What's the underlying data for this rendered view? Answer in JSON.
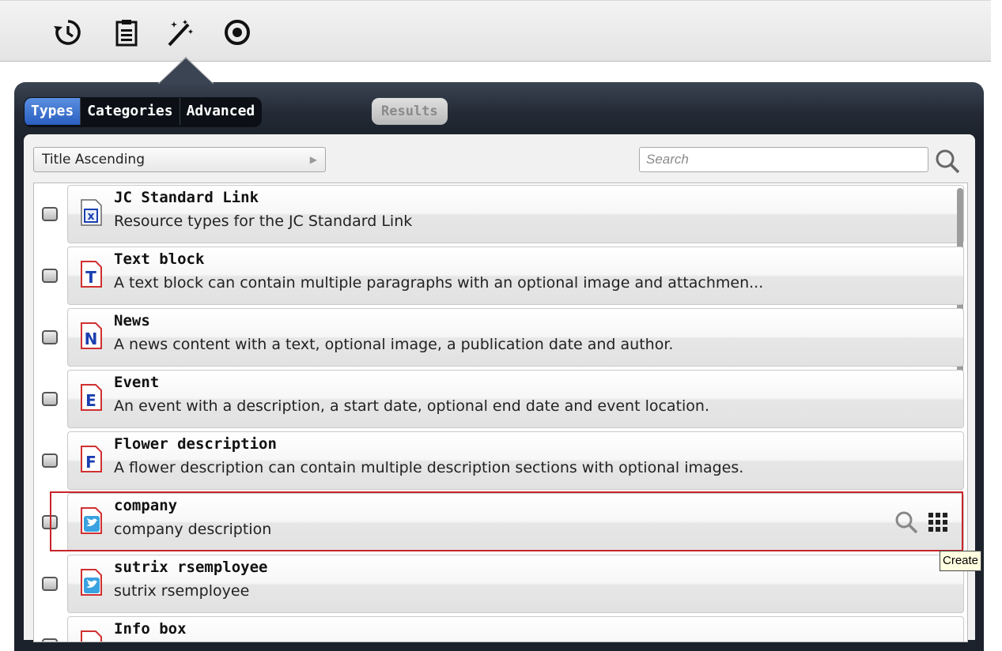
{
  "toolbar": {
    "icons": [
      "history-icon",
      "clipboard-icon",
      "magic-wand-icon",
      "target-icon"
    ]
  },
  "tabs": [
    {
      "label": "Types",
      "active": true
    },
    {
      "label": "Categories",
      "active": false
    },
    {
      "label": "Advanced",
      "active": false
    }
  ],
  "results_label": "Results",
  "sort": {
    "value": "Title Ascending"
  },
  "search": {
    "placeholder": "Search"
  },
  "items": [
    {
      "title": "JC Standard Link",
      "description": "Resource types for the JC Standard Link",
      "icon": "x-doc-icon",
      "letter": "x"
    },
    {
      "title": "Text block",
      "description": "A text block can contain multiple paragraphs with an optional image and attachmen...",
      "icon": "t-doc-icon",
      "letter": "T"
    },
    {
      "title": "News",
      "description": "A news content with a text, optional image, a publication date and author.",
      "icon": "n-doc-icon",
      "letter": "N"
    },
    {
      "title": "Event",
      "description": "An event with a description, a start date, optional end date and event location.",
      "icon": "e-doc-icon",
      "letter": "E"
    },
    {
      "title": "Flower description",
      "description": "A flower description can contain multiple description sections with optional images.",
      "icon": "f-doc-icon",
      "letter": "F"
    },
    {
      "title": "company",
      "description": "company description",
      "icon": "bird-doc-icon",
      "letter": ""
    },
    {
      "title": "sutrix rsemployee",
      "description": "sutrix rsemployee",
      "icon": "bird-doc-icon",
      "letter": ""
    },
    {
      "title": "Info box",
      "description": "",
      "icon": "doc-icon",
      "letter": ""
    }
  ],
  "tooltip": "Create",
  "colors": {
    "active_tab": "#2f6fd0",
    "highlight": "#c8242a",
    "panel": "#232a35"
  }
}
